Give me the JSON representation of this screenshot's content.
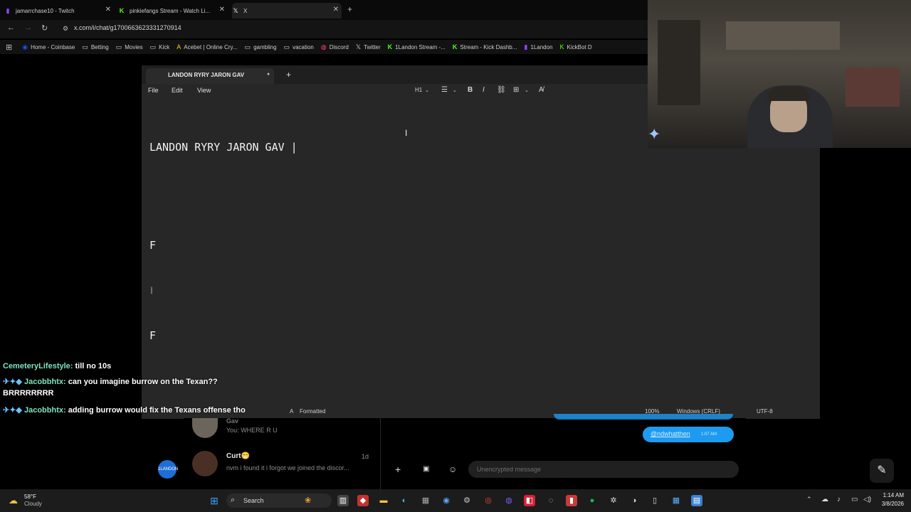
{
  "browser": {
    "tabs": [
      {
        "title": "jamarrchase10 - Twitch",
        "icon": "twitch-icon",
        "color": "#9146ff"
      },
      {
        "title": "pinkiefangs Stream - Watch Li...",
        "icon": "kick-icon",
        "color": "#53fc18"
      },
      {
        "title": "X",
        "icon": "x-icon",
        "color": "#ffffff"
      }
    ],
    "new_tab": "+",
    "url": "x.com/i/chat/g1700663623331270914",
    "bookmarks": [
      {
        "label": "Home - Coinbase",
        "icon": "coinbase-icon"
      },
      {
        "label": "Betting",
        "icon": "folder-icon"
      },
      {
        "label": "Movies",
        "icon": "folder-icon"
      },
      {
        "label": "Kick",
        "icon": "folder-icon"
      },
      {
        "label": "Acebet | Online Cry...",
        "icon": "acebet-icon"
      },
      {
        "label": "gambling",
        "icon": "folder-icon"
      },
      {
        "label": "vacation",
        "icon": "folder-icon"
      },
      {
        "label": "Discord",
        "icon": "discord-icon"
      },
      {
        "label": "Twitter",
        "icon": "x-icon"
      },
      {
        "label": "1Landon Stream -...",
        "icon": "kick-icon"
      },
      {
        "label": "Stream - Kick Dashb...",
        "icon": "kick-icon"
      },
      {
        "label": "1Landon",
        "icon": "twitch-icon"
      },
      {
        "label": "KickBot D",
        "icon": "kickbot-icon"
      }
    ]
  },
  "notepad": {
    "tab_title": "LANDON RYRY JARON GAV",
    "menu": [
      "File",
      "Edit",
      "View"
    ],
    "heading_selector": "H1",
    "lines": [
      "LANDON RYRY JARON GAV |",
      "",
      "F",
      "|",
      "F"
    ],
    "status": {
      "mode": "Formatted",
      "zoom": "100%",
      "line_ending": "Windows (CRLF)",
      "encoding": "UTF-8"
    }
  },
  "chat": [
    {
      "user": "CemeteryLifestyle:",
      "message": " till no 10s"
    },
    {
      "user": "Jacobbhtx:",
      "message": " can you imagine burrow on the Texan?? BRRRRRRRR"
    },
    {
      "user": "Jacobbhtx:",
      "message": " adding burrow would fix the Texans offense tho"
    }
  ],
  "dm": {
    "items": [
      {
        "name": "Gav",
        "preview": "You: WHERE R U",
        "time": ""
      },
      {
        "name": "Curt😁",
        "preview": "nvm i found it i forgot we joined the discor...",
        "time": "1d"
      }
    ],
    "bubble": "@ndwhatthen",
    "bubble_time": "1:07 AM",
    "input_placeholder": "Unencrypted message",
    "bubble_color": "#1d9bf0"
  },
  "taskbar": {
    "weather_temp": "58°F",
    "weather_desc": "Cloudy",
    "search_label": "Search",
    "time": "1:14 AM",
    "date": "3/8/2026"
  }
}
